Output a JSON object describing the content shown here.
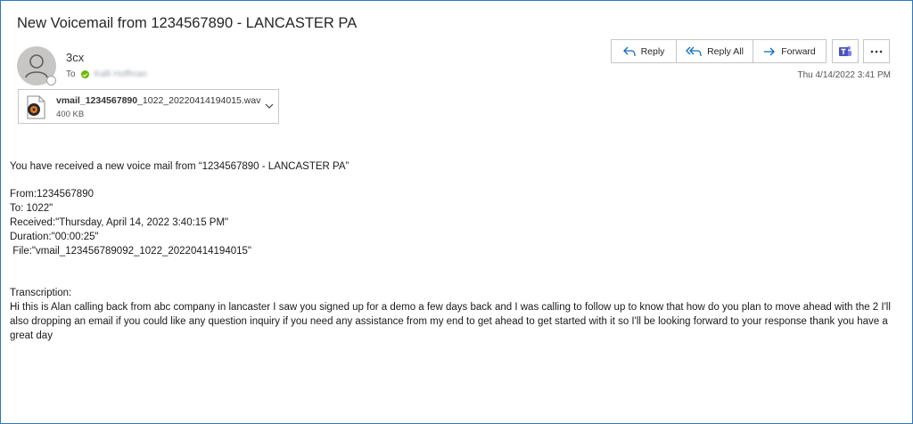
{
  "subject": "New Voicemail from 1234567890 - LANCASTER  PA",
  "sender": {
    "name": "3cx",
    "to_label": "To",
    "recipient": "Kalli Hoffman"
  },
  "attachment": {
    "filename_bold": "vmail_1234567890",
    "filename_rest": "_1022_20220414194015.wav",
    "size": "400 KB"
  },
  "actions": {
    "reply": "Reply",
    "reply_all": "Reply All",
    "forward": "Forward"
  },
  "date": "Thu 4/14/2022 3:41 PM",
  "body": {
    "intro": "You have received a new voice mail from “1234567890 - LANCASTER  PA”",
    "from": "From:1234567890",
    "to": "To: 1022\"",
    "received": "Received:\"Thursday, April 14, 2022 3:40:15 PM\"",
    "duration": "Duration:\"00:00:25\"",
    "file": " File:\"vmail_123456789092_1022_20220414194015\"",
    "transcription_label": "Transcription:",
    "transcription": "Hi this is Alan calling back from abc company in lancaster I saw you signed up for a demo a few days back and I was calling to follow up to know that how do you plan to move ahead with the 2 I'll also dropping an email if you could like any question inquiry if you need any assistance from my end to get ahead to get started with it so I'll be looking forward to your response thank you have a great day"
  },
  "colors": {
    "frame": "#2b78c5",
    "accent": "#0f6cbd",
    "presence": "#6bb700",
    "teams": "#4b53bc"
  }
}
